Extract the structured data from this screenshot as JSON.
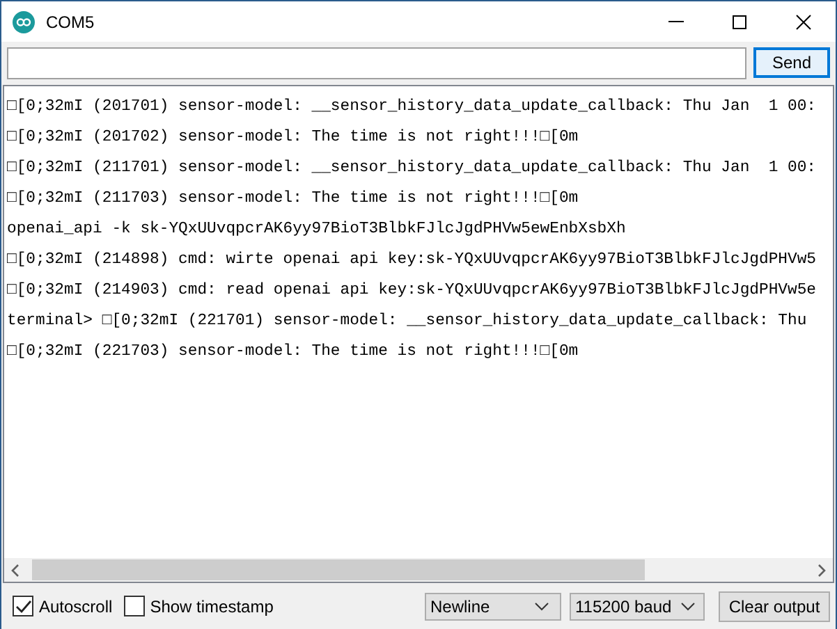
{
  "window": {
    "title": "COM5"
  },
  "send_button": "Send",
  "output_lines": [
    "□[0;32mI (201701) sensor-model: __sensor_history_data_update_callback: Thu Jan  1 00:",
    "□[0;32mI (201702) sensor-model: The time is not right!!!□[0m",
    "□[0;32mI (211701) sensor-model: __sensor_history_data_update_callback: Thu Jan  1 00:",
    "□[0;32mI (211703) sensor-model: The time is not right!!!□[0m",
    "openai_api -k 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",
    "□[0;32mI (214898) cmd: wirte openai api key:sk-YQxUUvqpcrAK6yy97BioT3BlbkFJlcJgdPHVw5",
    "□[0;32mI (214903) cmd: read openai api key:sk-YQxUUvqpcrAK6yy97BioT3BlbkFJlcJgdPHVw5e",
    "terminal> □[0;32mI (221701) sensor-model: __sensor_history_data_update_callback: Thu",
    "□[0;32mI (221703) sensor-model: The time is not right!!!□[0m"
  ],
  "options": [
    {
      "label": "Autoscroll",
      "checked": true
    },
    {
      "label": "Show timestamp",
      "checked": false
    }
  ],
  "line_ending": "Newline",
  "baud_rate": "115200 baud",
  "clear_button": "Clear output"
}
